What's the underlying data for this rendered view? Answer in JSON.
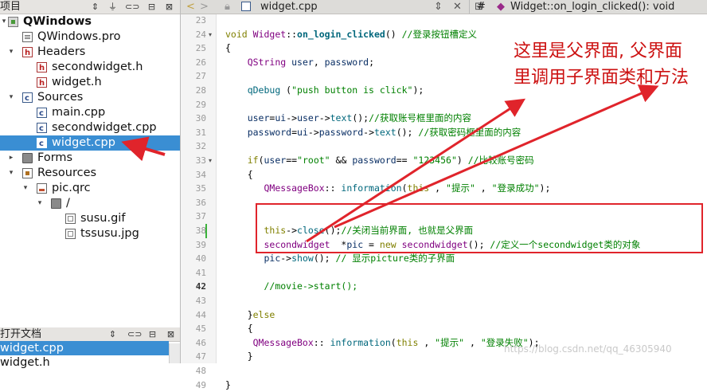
{
  "project_panel": {
    "title": "项目",
    "toolbar_icons": [
      "sort-icon",
      "filter-icon",
      "link-icon",
      "split-icon",
      "close-icon"
    ],
    "tree": [
      {
        "label": "QWindows",
        "icon": "project-icon",
        "bold": true
      },
      {
        "label": "QWindows.pro",
        "icon": "pro-file-icon"
      },
      {
        "label": "Headers",
        "icon": "headers-folder-icon"
      },
      {
        "label": "secondwidget.h",
        "icon": "header-file-icon"
      },
      {
        "label": "widget.h",
        "icon": "header-file-icon"
      },
      {
        "label": "Sources",
        "icon": "sources-folder-icon"
      },
      {
        "label": "main.cpp",
        "icon": "cpp-file-icon"
      },
      {
        "label": "secondwidget.cpp",
        "icon": "cpp-file-icon"
      },
      {
        "label": "widget.cpp",
        "icon": "cpp-file-icon",
        "selected": true
      },
      {
        "label": "Forms",
        "icon": "forms-folder-icon"
      },
      {
        "label": "Resources",
        "icon": "resources-folder-icon"
      },
      {
        "label": "pic.qrc",
        "icon": "qrc-file-icon"
      },
      {
        "label": "/",
        "icon": "folder-icon"
      },
      {
        "label": "susu.gif",
        "icon": "image-file-icon"
      },
      {
        "label": "tssusu.jpg",
        "icon": "image-file-icon"
      }
    ]
  },
  "open_documents": {
    "title": "打开文档",
    "items": [
      "widget.cpp",
      "widget.h"
    ]
  },
  "editor": {
    "file_name": "widget.cpp",
    "symbol": "Widget::on_login_clicked(): void",
    "hash_label": "#",
    "lines": [
      {
        "n": "23",
        "code": ""
      },
      {
        "n": "24",
        "code": "void Widget::on_login_clicked() //登录按钮槽定义"
      },
      {
        "n": "25",
        "code": "{"
      },
      {
        "n": "26",
        "code": "    QString user, password;"
      },
      {
        "n": "27",
        "code": ""
      },
      {
        "n": "28",
        "code": "    qDebug (\"push button is click\");"
      },
      {
        "n": "29",
        "code": ""
      },
      {
        "n": "30",
        "code": "    user=ui->user->text();//获取账号框里面的内容"
      },
      {
        "n": "31",
        "code": "    password=ui->password->text(); //获取密码框里面的内容"
      },
      {
        "n": "32",
        "code": ""
      },
      {
        "n": "33",
        "code": "    if(user==\"root\" && password== \"123456\") //比较账号密码"
      },
      {
        "n": "34",
        "code": "    {"
      },
      {
        "n": "35",
        "code": "       QMessageBox:: information(this , \"提示\" , \"登录成功\");"
      },
      {
        "n": "36",
        "code": ""
      },
      {
        "n": "37",
        "code": ""
      },
      {
        "n": "38",
        "code": "       this->close();//关闭当前界面, 也就是父界面"
      },
      {
        "n": "39",
        "code": "       secondwidget  *pic = new secondwidget(); //定义一个secondwidget类的对象"
      },
      {
        "n": "40",
        "code": "       pic->show(); // 显示picture类的子界面"
      },
      {
        "n": "41",
        "code": ""
      },
      {
        "n": "42",
        "code": "       //movie->start();"
      },
      {
        "n": "43",
        "code": ""
      },
      {
        "n": "44",
        "code": "    }else"
      },
      {
        "n": "45",
        "code": "    {"
      },
      {
        "n": "46",
        "code": "     QMessageBox:: information(this , \"提示\" , \"登录失败\");"
      },
      {
        "n": "47",
        "code": "    }"
      },
      {
        "n": "48",
        "code": ""
      },
      {
        "n": "49",
        "code": "}"
      }
    ],
    "current_line": "42"
  },
  "annotation": {
    "text": "这里是父界面, 父界面里调用子界面类和方法",
    "color": "#cc1111"
  },
  "watermark": "https://blog.csdn.net/qq_46305940",
  "colors": {
    "selection": "#3a8ed3",
    "annotation_red": "#e0242b"
  }
}
